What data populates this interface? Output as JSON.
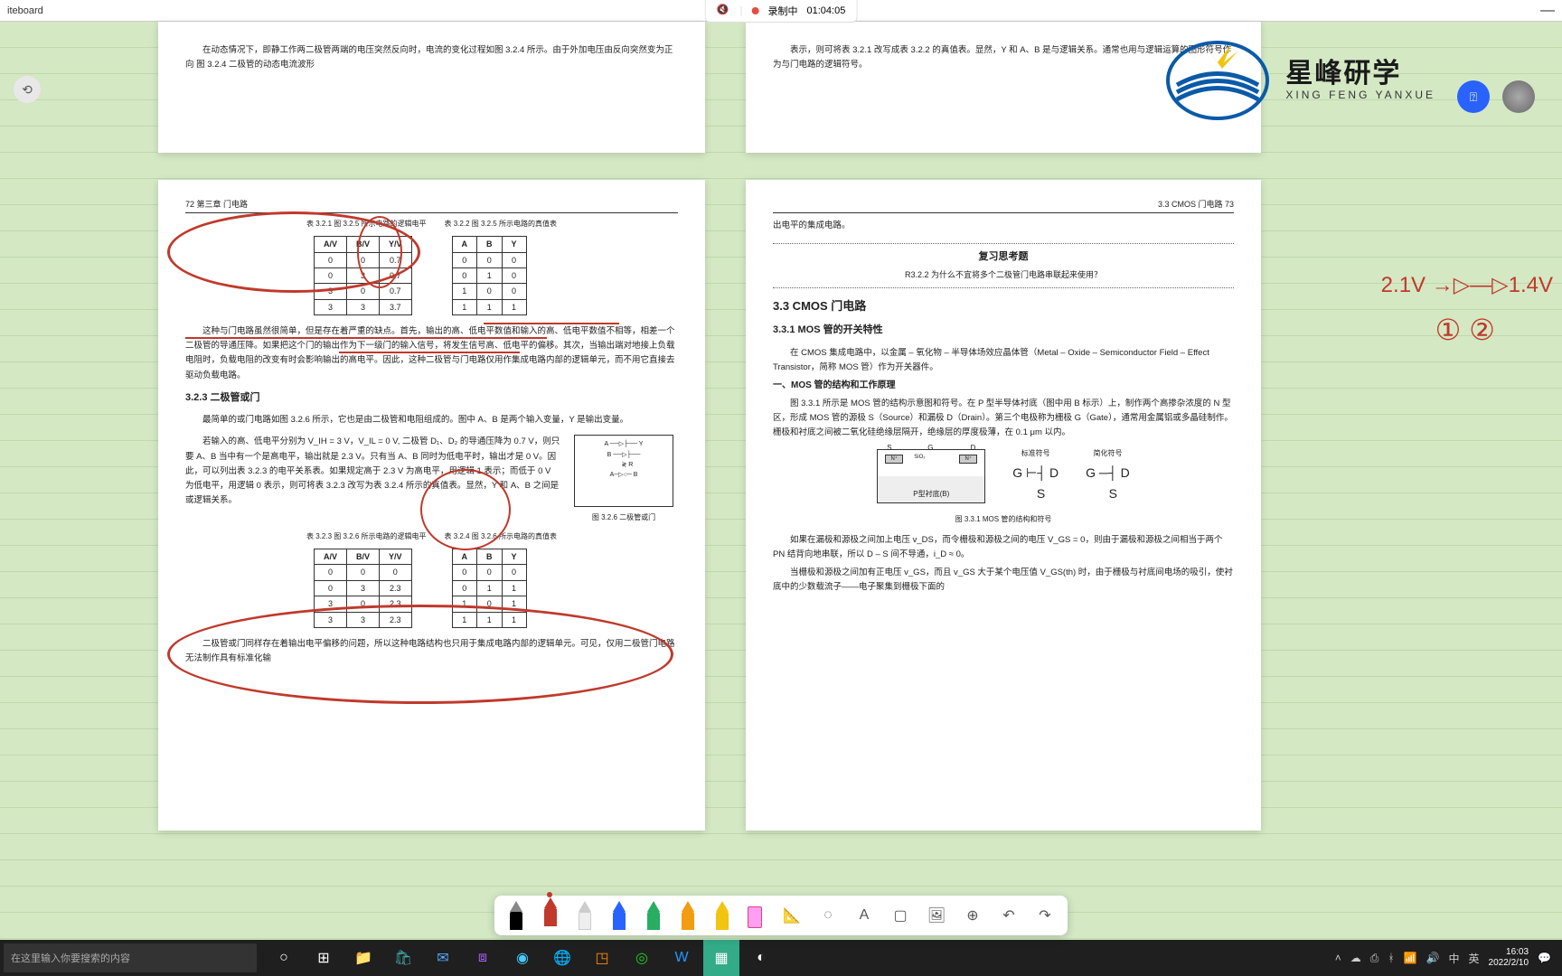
{
  "titlebar": {
    "title": "iteboard"
  },
  "recording": {
    "label": "录制中",
    "time": "01:04:05"
  },
  "logo": {
    "main": "星峰研学",
    "sub": "XING FENG YANXUE"
  },
  "page_tl": {
    "text": "在动态情况下，即静工作两二极管两端的电压突然反向时，电流的变化过程如图 3.2.4 所示。由于外加电压由反向突然变为正向  图 3.2.4  二极管的动态电流波形"
  },
  "page_tr": {
    "text": "表示，则可将表 3.2.1 改写成表 3.2.2 的真值表。显然，Y 和 A、B 是与逻辑关系。通常也用与逻辑运算的图形符号作为与门电路的逻辑符号。"
  },
  "page_bl": {
    "header": "72  第三章  门电路",
    "tbl321_cap": "表 3.2.1  图 3.2.5 所示电路的逻辑电平",
    "tbl322_cap": "表 3.2.2  图 3.2.5 所示电路的真值表",
    "tbl321_head": [
      "A/V",
      "B/V",
      "Y/V"
    ],
    "tbl321_rows": [
      [
        "0",
        "0",
        "0.7"
      ],
      [
        "0",
        "3",
        "0.7"
      ],
      [
        "3",
        "0",
        "0.7"
      ],
      [
        "3",
        "3",
        "3.7"
      ]
    ],
    "tbl322_head": [
      "A",
      "B",
      "Y"
    ],
    "tbl322_rows": [
      [
        "0",
        "0",
        "0"
      ],
      [
        "0",
        "1",
        "0"
      ],
      [
        "1",
        "0",
        "0"
      ],
      [
        "1",
        "1",
        "1"
      ]
    ],
    "para1": "这种与门电路虽然很简单，但是存在着严重的缺点。首先，输出的高、低电平数值和输入的高、低电平数值不相等，相差一个二极管的导通压降。如果把这个门的输出作为下一级门的输入信号，将发生信号高、低电平的偏移。其次，当输出端对地接上负载电阻时，负载电阻的改变有时会影响输出的高电平。因此，这种二极管与门电路仅用作集成电路内部的逻辑单元，而不用它直接去驱动负载电路。",
    "sec323": "3.2.3  二极管或门",
    "para2": "最简单的或门电路如图 3.2.6 所示，它也是由二极管和电阻组成的。图中 A、B 是两个输入变量，Y 是输出变量。",
    "para3": "若输入的高、低电平分别为 V_IH = 3 V，V_IL = 0 V, 二极管 D₁、D₂ 的导通压降为 0.7 V，则只要 A、B 当中有一个是高电平，输出就是 2.3 V。只有当 A、B 同时为低电平时，输出才是 0 V。因此，可以列出表 3.2.3 的电平关系表。如果规定高于 2.3 V 为高电平，用逻辑 1 表示；而低于 0 V 为低电平，用逻辑 0 表示，则可将表 3.2.3 改写为表 3.2.4 所示的真值表。显然，Y 和 A、B 之间是或逻辑关系。",
    "fig326": "图 3.2.6  二极管或门",
    "tbl323_cap": "表 3.2.3  图 3.2.6 所示电路的逻辑电平",
    "tbl324_cap": "表 3.2.4  图 3.2.6 所示电路的真值表",
    "tbl323_head": [
      "A/V",
      "B/V",
      "Y/V"
    ],
    "tbl323_rows": [
      [
        "0",
        "0",
        "0"
      ],
      [
        "0",
        "3",
        "2.3"
      ],
      [
        "3",
        "0",
        "2.3"
      ],
      [
        "3",
        "3",
        "2.3"
      ]
    ],
    "tbl324_head": [
      "A",
      "B",
      "Y"
    ],
    "tbl324_rows": [
      [
        "0",
        "0",
        "0"
      ],
      [
        "0",
        "1",
        "1"
      ],
      [
        "1",
        "0",
        "1"
      ],
      [
        "1",
        "1",
        "1"
      ]
    ],
    "para4": "二极管或门同样存在着输出电平偏移的问题，所以这种电路结构也只用于集成电路内部的逻辑单元。可见，仅用二极管门电路无法制作具有标准化输"
  },
  "page_br": {
    "header": "3.3  CMOS 门电路  73",
    "para0": "出电平的集成电路。",
    "review_title": "复习思考题",
    "review_q": "R3.2.2  为什么不宜将多个二极管门电路串联起来使用？",
    "sec33": "3.3  CMOS 门电路",
    "sec331": "3.3.1  MOS 管的开关特性",
    "para1": "在 CMOS 集成电路中，以金属 – 氧化物 – 半导体场效应晶体管（Metal – Oxide – Semiconductor Field – Effect Transistor，简称 MOS 管）作为开关器件。",
    "sub1": "一、MOS 管的结构和工作原理",
    "para2": "图 3.3.1 所示是 MOS 管的结构示意图和符号。在 P 型半导体衬底（图中用 B 标示）上，制作两个高掺杂浓度的 N 型区，形成 MOS 管的源极 S（Source）和漏极 D（Drain）。第三个电极称为栅极 G（Gate），通常用金属铝或多晶硅制作。栅极和衬底之间被二氧化硅绝缘层隔开，绝缘层的厚度极薄，在 0.1 μm 以内。",
    "fig331": "图 3.3.1  MOS 管的结构和符号",
    "fig_labels": {
      "std": "标准符号",
      "simp": "简化符号",
      "substrate": "P型衬底(B)"
    },
    "para3": "如果在漏极和源极之间加上电压 v_DS，而令栅极和源极之间的电压 V_GS = 0，则由于漏极和源极之间相当于两个 PN 结背向地串联，所以 D – S 间不导通，i_D ≈ 0。",
    "para4": "当栅极和源极之间加有正电压 v_GS，而且 v_GS 大于某个电压值 V_GS(th) 时，由于栅极与衬底间电场的吸引，使衬底中的少数载流子——电子聚集到栅极下面的"
  },
  "handnote": {
    "line1": "2.1V →▷—▷1.4V",
    "line2": "① ②"
  },
  "toolbar": {
    "pens": [
      {
        "color": "#000",
        "tip": "#888"
      },
      {
        "color": "#c0392b",
        "tip": "#c0392b",
        "active": true
      },
      {
        "color": "#e8e8e8",
        "tip": "#888"
      },
      {
        "color": "#2962ff",
        "tip": "#2962ff"
      },
      {
        "color": "#27ae60",
        "tip": "#27ae60"
      },
      {
        "color": "#f39c12",
        "tip": "#f39c12"
      },
      {
        "color": "#f1c40f",
        "tip": "#f1c40f",
        "hl": true
      },
      {
        "color": "#ff9ff3",
        "tip": "#ff9ff3",
        "eraser": true
      }
    ]
  },
  "taskbar": {
    "search_placeholder": "在这里输入你要搜索的内容",
    "time": "16:03",
    "date": "2022/2/10",
    "ime": "英",
    "lang": "中"
  }
}
